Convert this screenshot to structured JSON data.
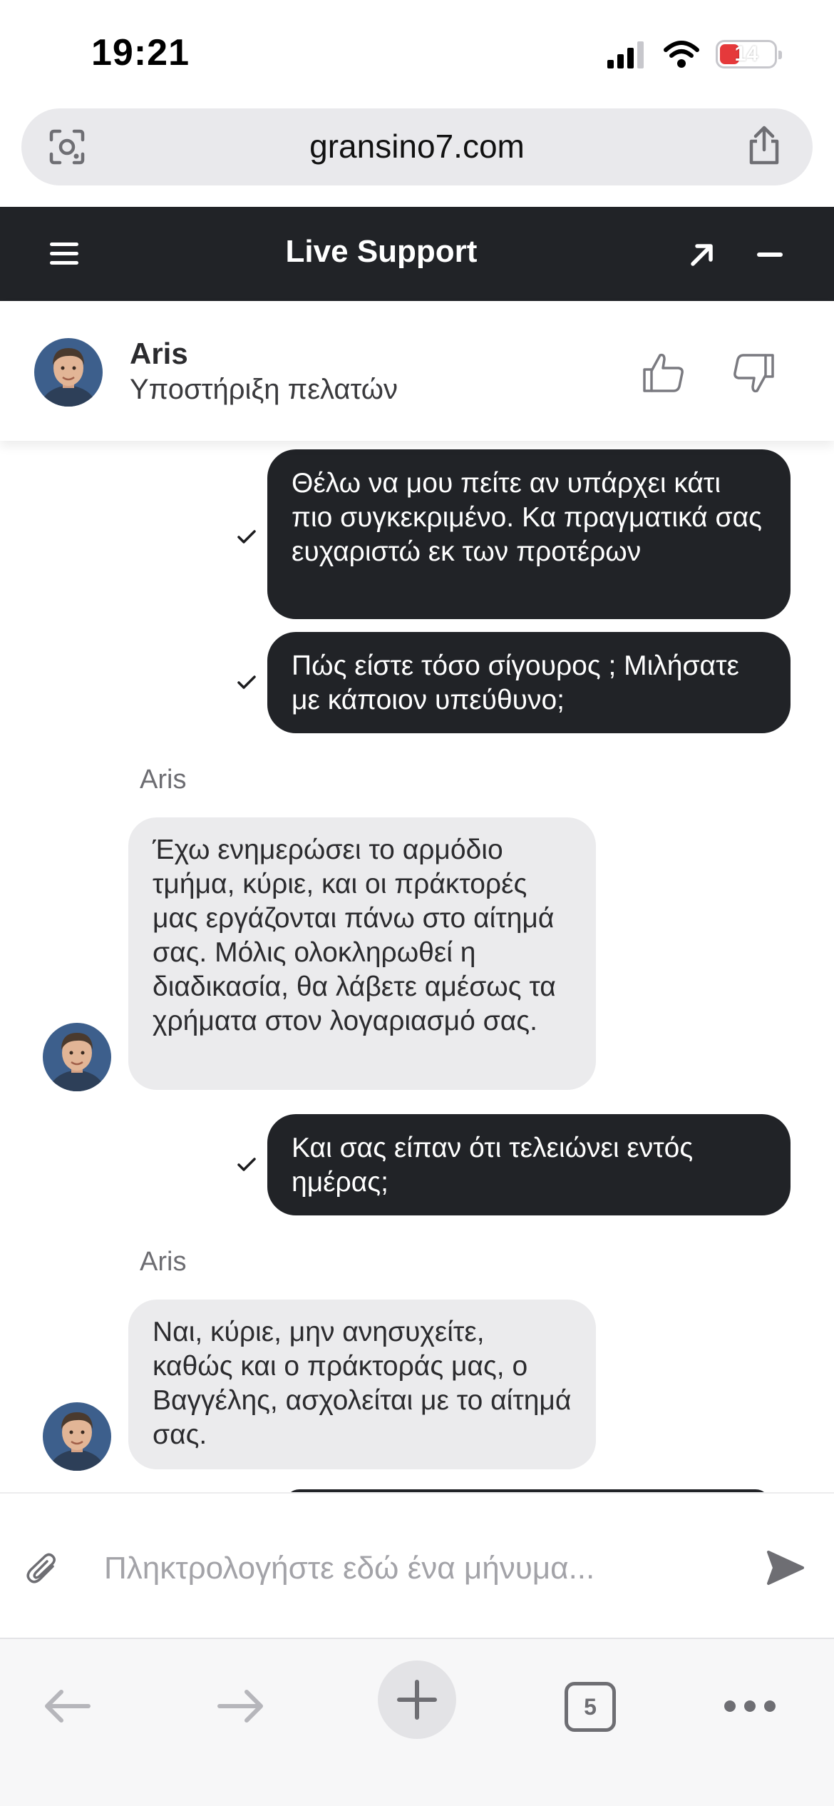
{
  "status_bar": {
    "time": "19:21",
    "battery": "14"
  },
  "browser": {
    "url": "gransino7.com",
    "tab_count": "5"
  },
  "header": {
    "title": "Live Support"
  },
  "agent": {
    "name": "Aris",
    "role": "Υποστήριξη πελατών"
  },
  "messages": [
    {
      "from": "user",
      "text": "Θέλω να μου πείτε αν υπάρχει κάτι πιο συγκεκριμένο. Κα πραγματικά σας ευχαριστώ εκ των προτέρων",
      "read": true
    },
    {
      "from": "user",
      "text": "Πώς είστε τόσο σίγουρος ; Μιλήσατε με κάποιον υπεύθυνο;",
      "read": true
    },
    {
      "from": "agent",
      "sender": "Aris",
      "text": "Έχω ενημερώσει το αρμόδιο τμήμα, κύριε, και οι πράκτορές μας εργάζονται πάνω στο αίτημά σας. Μόλις ολοκληρωθεί η διαδικασία, θα λάβετε αμέσως τα χρήματα στον λογαριασμό σας."
    },
    {
      "from": "user",
      "text": "Και σας είπαν ότι τελειώνει εντός ημέρας;",
      "read": true
    },
    {
      "from": "agent",
      "sender": "Aris",
      "text": "Ναι, κύριε, μην ανησυχείτε, καθώς και ο πράκτοράς μας, ο Βαγγέλης, ασχολείται με το αίτημά σας."
    }
  ],
  "composer": {
    "placeholder": "Πληκτρολογήστε εδώ ένα μήνυμα..."
  },
  "colors": {
    "header_bg": "#212327",
    "outgoing_bubble": "#212327",
    "incoming_bubble": "#ebebed"
  }
}
